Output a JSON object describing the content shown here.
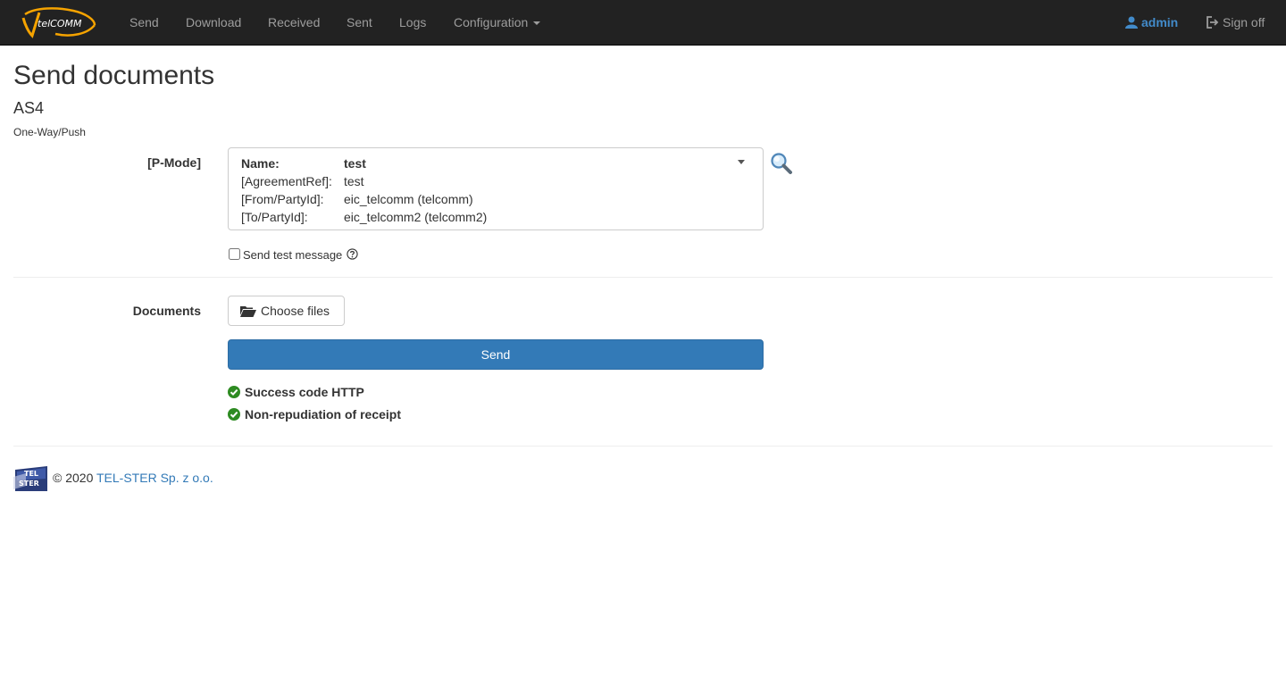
{
  "nav": {
    "brand_text": "telCOMM",
    "items": [
      {
        "label": "Send"
      },
      {
        "label": "Download"
      },
      {
        "label": "Received"
      },
      {
        "label": "Sent"
      },
      {
        "label": "Logs"
      },
      {
        "label": "Configuration"
      }
    ],
    "user": "admin",
    "signoff": "Sign off"
  },
  "page": {
    "title": "Send documents",
    "subtitle": "AS4",
    "profile": "One-Way/Push"
  },
  "pmode": {
    "label": "[P-Mode]",
    "rows": [
      {
        "key": "Name:",
        "value": "test"
      },
      {
        "key": "[AgreementRef]:",
        "value": "test"
      },
      {
        "key": "[From/PartyId]:",
        "value": "eic_telcomm (telcomm)"
      },
      {
        "key": "[To/PartyId]:",
        "value": "eic_telcomm2 (telcomm2)"
      }
    ]
  },
  "test_message": {
    "label": "Send test message",
    "checked": false
  },
  "documents": {
    "label": "Documents",
    "choose_label": "Choose files"
  },
  "send_label": "Send",
  "status_items": [
    {
      "label": "Success code HTTP"
    },
    {
      "label": "Non-repudiation of receipt"
    }
  ],
  "footer": {
    "logo_top": "TEL",
    "logo_bottom": "STER",
    "copyright": "© 2020",
    "company": "TEL-STER Sp. z o.o."
  },
  "colors": {
    "navbar": "#222222",
    "nav_text": "#9d9d9d",
    "primary": "#337ab7",
    "success": "#2e8b22"
  }
}
